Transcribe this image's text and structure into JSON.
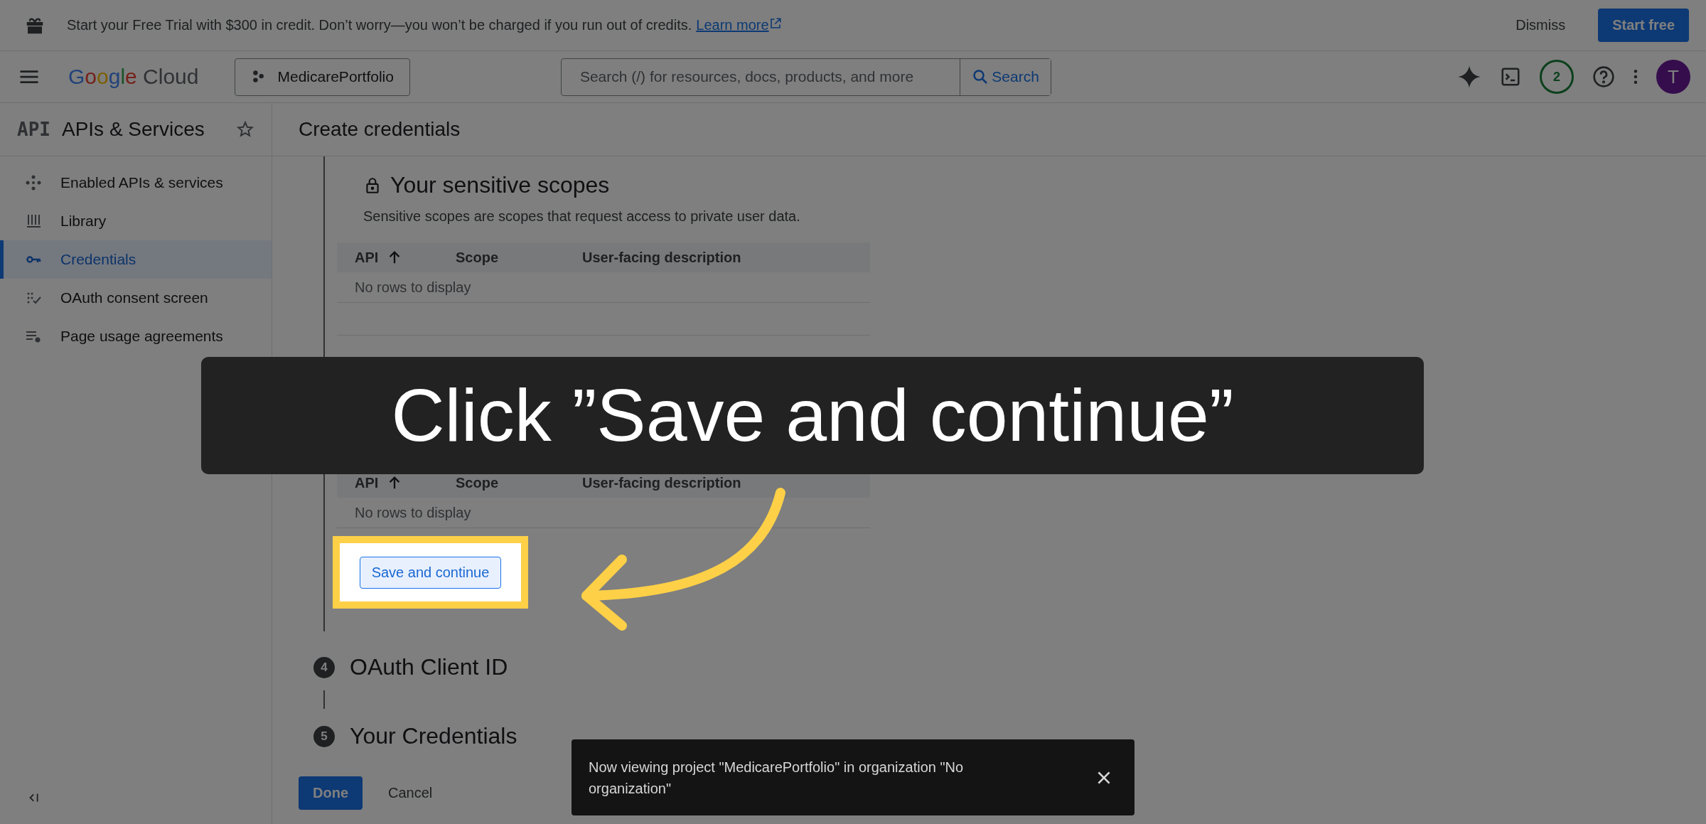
{
  "promo_banner": {
    "text": "Start your Free Trial with $300 in credit. Don’t worry—you won’t be charged if you run out of credits.",
    "link": "Learn more",
    "dismiss": "Dismiss",
    "start": "Start free"
  },
  "header": {
    "logo_word": "Google",
    "logo_product": "Cloud",
    "project": "MedicarePortfolio",
    "search": {
      "placeholder": "Search (/) for resources, docs, products, and more",
      "button": "Search"
    },
    "notifications": "2",
    "avatar": "T"
  },
  "sidebar": {
    "badge": "API",
    "title": "APIs & Services",
    "items": [
      {
        "label": "Enabled APIs & services",
        "selected": false
      },
      {
        "label": "Library",
        "selected": false
      },
      {
        "label": "Credentials",
        "selected": true
      },
      {
        "label": "OAuth consent screen",
        "selected": false
      },
      {
        "label": "Page usage agreements",
        "selected": false
      }
    ]
  },
  "page": {
    "title": "Create credentials",
    "sensitive_scopes": {
      "heading": "Your sensitive scopes",
      "description": "Sensitive scopes are scopes that request access to private user data.",
      "columns": [
        "API",
        "Scope",
        "User-facing description"
      ],
      "empty": "No rows to display"
    },
    "restricted_scopes": {
      "columns": [
        "API",
        "Scope",
        "User-facing description"
      ],
      "empty": "No rows to display"
    },
    "save_button": "Save and continue",
    "steps": [
      {
        "number": "4",
        "label": "OAuth Client ID"
      },
      {
        "number": "5",
        "label": "Your Credentials"
      }
    ],
    "done": "Done",
    "cancel": "Cancel"
  },
  "snackbar": {
    "message": "Now viewing project \"MedicarePortfolio\" in organization \"No organization\""
  },
  "tutorial": {
    "caption": "Click ”Save and continue”"
  }
}
